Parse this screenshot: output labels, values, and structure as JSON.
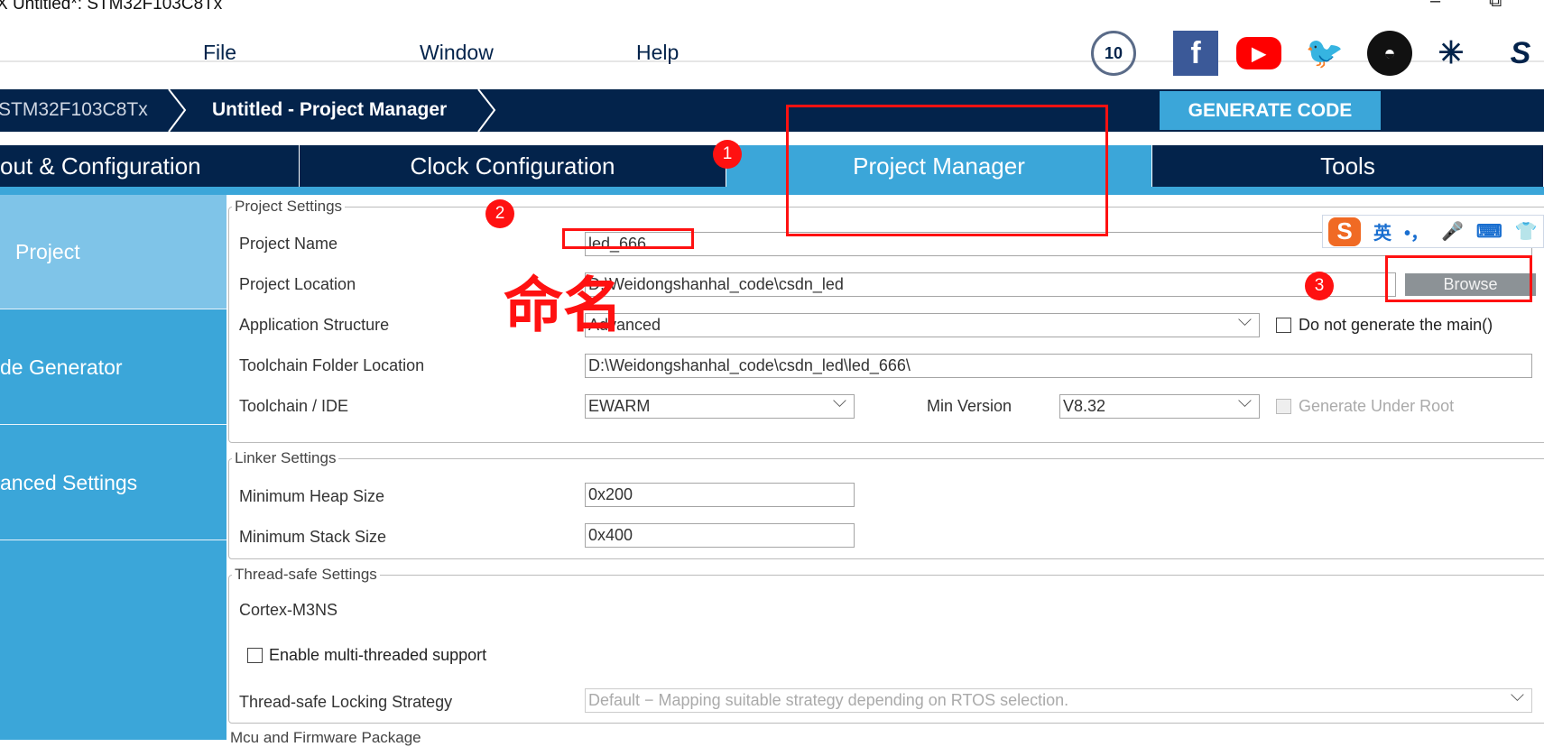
{
  "window": {
    "title": "X Untitled*: STM32F103C8Tx",
    "minimize": "–",
    "restore": "⧉"
  },
  "menu": {
    "items": [
      "File",
      "Window",
      "Help"
    ]
  },
  "social_icons": [
    "anniversary-10-badge",
    "facebook-icon",
    "youtube-icon",
    "twitter-icon",
    "github-icon",
    "network-icon",
    "st-logo"
  ],
  "breadcrumb": {
    "items": [
      "STM32F103C8Tx",
      "Untitled - Project Manager"
    ]
  },
  "generate_label": "GENERATE CODE",
  "tabs": [
    {
      "label": "out & Configuration"
    },
    {
      "label": "Clock Configuration"
    },
    {
      "label": "Project Manager",
      "active": true
    },
    {
      "label": "Tools"
    }
  ],
  "sidebar": {
    "items": [
      {
        "label": "Project",
        "active": true
      },
      {
        "label": "de Generator"
      },
      {
        "label": "anced Settings"
      }
    ]
  },
  "project_settings": {
    "title": "Project Settings",
    "name_label": "Project Name",
    "name_value": "led_666",
    "location_label": "Project Location",
    "location_value": "D:\\Weidongshanhal_code\\csdn_led",
    "browse": "Browse",
    "structure_label": "Application Structure",
    "structure_value": "Advanced",
    "no_main": "Do not generate the main()",
    "toolchain_folder_label": "Toolchain Folder Location",
    "toolchain_folder_value": "D:\\Weidongshanhal_code\\csdn_led\\led_666\\",
    "ide_label": "Toolchain / IDE",
    "ide_value": "EWARM",
    "min_version_label": "Min Version",
    "min_version_value": "V8.32",
    "under_root": "Generate Under Root"
  },
  "linker": {
    "title": "Linker Settings",
    "heap_label": "Minimum Heap Size",
    "heap_value": "0x200",
    "stack_label": "Minimum Stack Size",
    "stack_value": "0x400"
  },
  "thread": {
    "title": "Thread-safe Settings",
    "core": "Cortex-M3NS",
    "multi": "Enable multi-threaded support",
    "strategy_label": "Thread-safe Locking Strategy",
    "strategy_value": "Default  −  Mapping suitable strategy depending on RTOS selection."
  },
  "mcu_title": "Mcu and Firmware Package",
  "annotations": {
    "step1": "1",
    "step2": "2",
    "step3": "3",
    "naming": "命名",
    "color": "#ff1111"
  },
  "ime": {
    "lang": "英",
    "punct": "•，"
  }
}
